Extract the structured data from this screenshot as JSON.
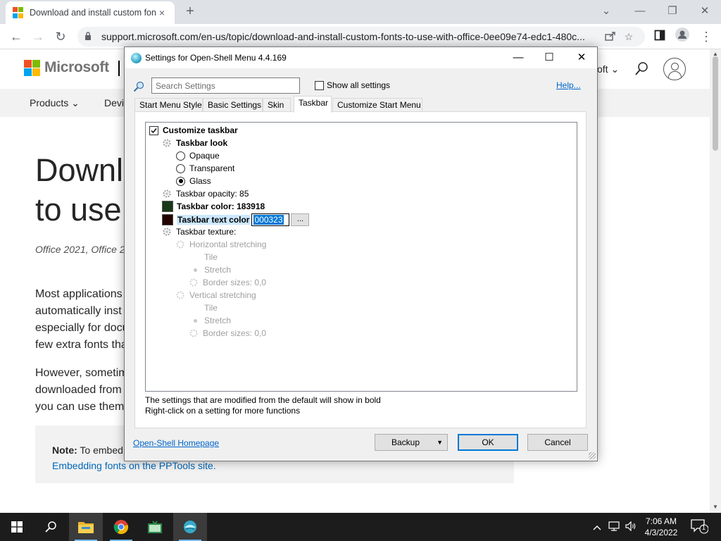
{
  "browser": {
    "tab_title": "Download and install custom fon",
    "tab_close": "×",
    "new_tab": "+",
    "url": "support.microsoft.com/en-us/topic/download-and-install-custom-fonts-to-use-with-office-0ee09e74-edc1-480c...",
    "back": "←",
    "forward": "→",
    "reload": "↻",
    "minimize": "⌄",
    "min": "—",
    "restore": "❐",
    "close": "✕"
  },
  "ms_page": {
    "logo_text": "Microsoft",
    "all_microsoft": "oft ⌄",
    "nav": [
      {
        "label": "Products ⌄"
      },
      {
        "label": "Devi"
      }
    ],
    "title_line1": "Downl",
    "title_line2": "to use",
    "meta": "Office 2021, Office 2",
    "para1": [
      "Most applications",
      "automatically inst",
      "especially for docu",
      "few extra fonts tha"
    ],
    "para2": [
      "However, sometim",
      "downloaded from",
      "you can use them"
    ],
    "note_label": "Note:",
    "note_text": " To embed",
    "note_link": "Embedding fonts on the PPTools site."
  },
  "dialog": {
    "title": "Settings for Open-Shell Menu 4.4.169",
    "min": "—",
    "max": "☐",
    "close": "✕",
    "search_placeholder": "Search Settings",
    "show_all_label": "Show all settings",
    "help_label": "Help...",
    "tabs": [
      {
        "label": "Start Menu Style"
      },
      {
        "label": "Basic Settings"
      },
      {
        "label": "Skin"
      },
      {
        "label": "Taskbar"
      },
      {
        "label": "Customize Start Menu"
      }
    ],
    "active_tab": "Taskbar",
    "tree": {
      "customize_taskbar": "Customize taskbar",
      "taskbar_look": "Taskbar look",
      "opaque": "Opaque",
      "transparent": "Transparent",
      "glass": "Glass",
      "taskbar_opacity": "Taskbar opacity: 85",
      "taskbar_color": "Taskbar color: 183918",
      "taskbar_color_hex": "#183918",
      "taskbar_text_color": "Taskbar text color",
      "taskbar_text_color_value": "000323",
      "taskbar_text_color_hex": "#230300",
      "browse": "...",
      "taskbar_texture": "Taskbar texture:",
      "horizontal_stretching": "Horizontal stretching",
      "h_tile": "Tile",
      "h_stretch": "Stretch",
      "h_border": "Border sizes: 0,0",
      "vertical_stretching": "Vertical stretching",
      "v_tile": "Tile",
      "v_stretch": "Stretch",
      "v_border": "Border sizes: 0,0"
    },
    "hint1": "The settings that are modified from the default will show in bold",
    "hint2": "Right-click on a setting for more functions",
    "homepage_link": "Open-Shell Homepage",
    "backup_button": "Backup",
    "backup_arrow": "▼",
    "ok_button": "OK",
    "cancel_button": "Cancel"
  },
  "taskbar": {
    "time": "7:06 AM",
    "date": "4/3/2022",
    "notification_count": "1"
  }
}
